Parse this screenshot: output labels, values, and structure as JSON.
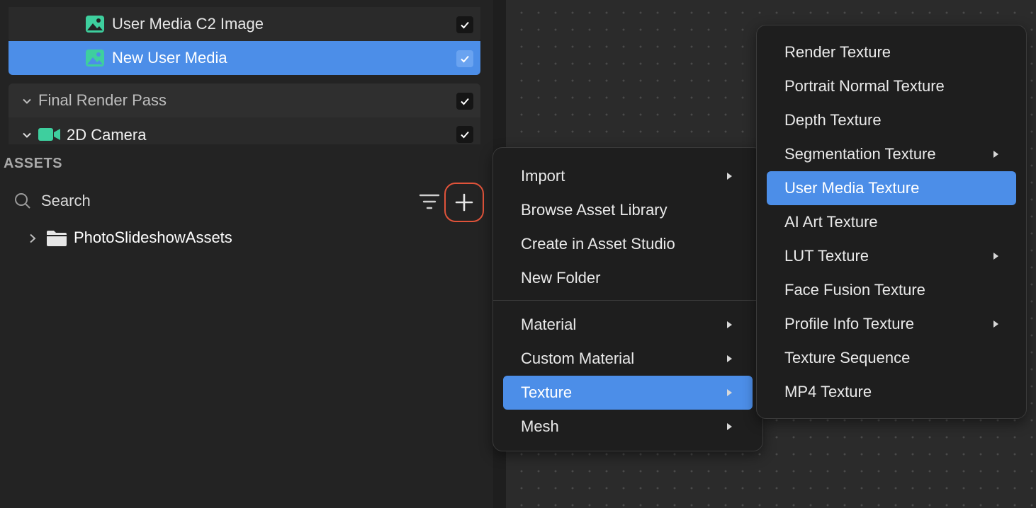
{
  "scene": {
    "rows": [
      {
        "label": "User Media C2 Image",
        "checked": true
      },
      {
        "label": "New User Media",
        "checked": true,
        "selected": true
      },
      {
        "label": "Final Render Pass",
        "checked": true
      },
      {
        "label": "2D Camera",
        "checked": true
      }
    ]
  },
  "assets": {
    "title": "ASSETS",
    "search_label": "Search",
    "folder": "PhotoSlideshowAssets"
  },
  "add_menu": {
    "items": [
      {
        "label": "Import",
        "submenu": true
      },
      {
        "label": "Browse Asset Library"
      },
      {
        "label": "Create in Asset Studio"
      },
      {
        "label": "New Folder"
      },
      {
        "label": "Material",
        "submenu": true
      },
      {
        "label": "Custom Material",
        "submenu": true
      },
      {
        "label": "Texture",
        "submenu": true,
        "active": true
      },
      {
        "label": "Mesh",
        "submenu": true
      }
    ]
  },
  "texture_menu": {
    "items": [
      {
        "label": "Render Texture"
      },
      {
        "label": "Portrait Normal Texture"
      },
      {
        "label": "Depth Texture"
      },
      {
        "label": "Segmentation Texture",
        "submenu": true
      },
      {
        "label": "User Media Texture",
        "active": true
      },
      {
        "label": "AI Art Texture"
      },
      {
        "label": "LUT Texture",
        "submenu": true
      },
      {
        "label": "Face Fusion Texture"
      },
      {
        "label": "Profile Info Texture",
        "submenu": true
      },
      {
        "label": "Texture Sequence"
      },
      {
        "label": "MP4 Texture"
      }
    ]
  },
  "colors": {
    "accent": "#4c8ee8",
    "highlight_ring": "#e0533a",
    "scene_icon": "#3ecf9e"
  }
}
